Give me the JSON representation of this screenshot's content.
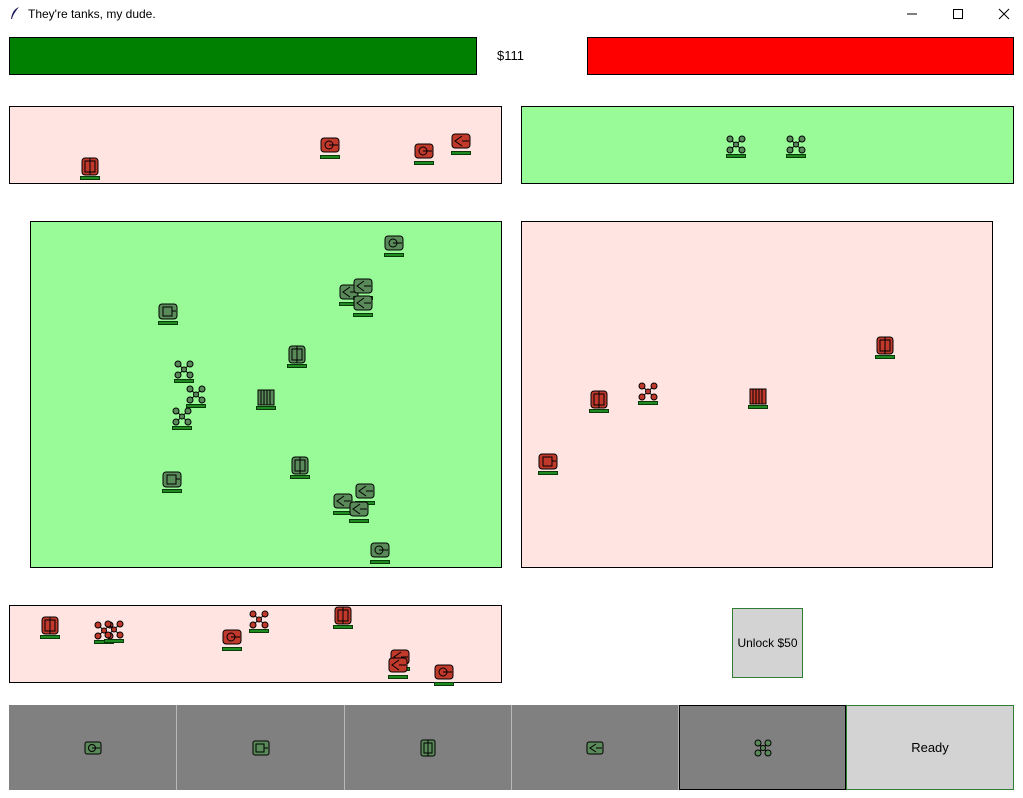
{
  "window": {
    "title": "They're tanks, my dude."
  },
  "hud": {
    "money": "$111",
    "player_bar_color": "#008000",
    "enemy_bar_color": "#ff0000"
  },
  "colors": {
    "player_zone": "#98fb98",
    "enemy_zone": "#ffe4e1",
    "player_unit": "#5a8a5a",
    "enemy_unit": "#c0392b",
    "hp": "#1f8a1f",
    "shop_slot": "#808080",
    "button": "#d3d3d3"
  },
  "zones": [
    {
      "name": "top-left",
      "owner": "enemy",
      "icon": "zone"
    },
    {
      "name": "top-right",
      "owner": "player",
      "icon": "zone"
    },
    {
      "name": "center-left",
      "owner": "player",
      "icon": "zone"
    },
    {
      "name": "center-right",
      "owner": "enemy",
      "icon": "zone"
    },
    {
      "name": "bottom-left",
      "owner": "enemy",
      "icon": "zone"
    }
  ],
  "shop": {
    "items": [
      {
        "icon": "light-tank-icon",
        "selected": false
      },
      {
        "icon": "medium-tank-icon",
        "selected": false
      },
      {
        "icon": "heavy-tank-icon",
        "selected": false
      },
      {
        "icon": "artillery-tank-icon",
        "selected": false
      },
      {
        "icon": "quad-drone-icon",
        "selected": true
      }
    ],
    "ready_label": "Ready",
    "unlock_label": "Unlock $50"
  }
}
